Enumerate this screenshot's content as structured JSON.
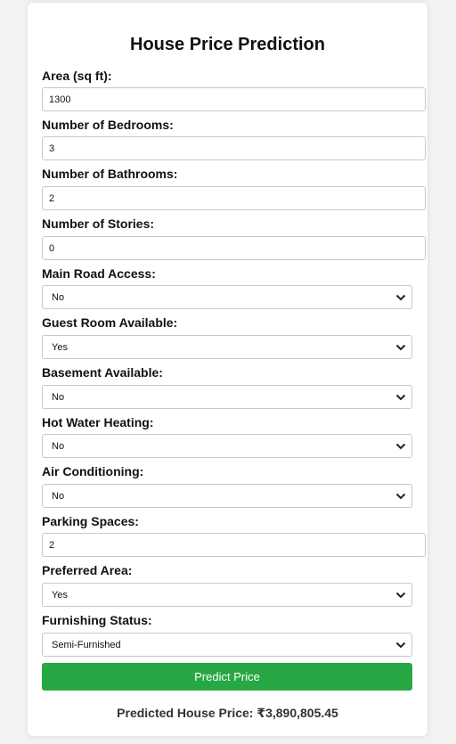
{
  "page_title": "House Price Prediction",
  "fields": [
    {
      "label": "Area (sq ft):",
      "value": "1300"
    },
    {
      "label": "Number of Bedrooms:",
      "value": "3"
    },
    {
      "label": "Number of Bathrooms:",
      "value": "2"
    },
    {
      "label": "Number of Stories:",
      "value": "0"
    },
    {
      "label": "Main Road Access:",
      "value": "No"
    },
    {
      "label": "Guest Room Available:",
      "value": "Yes"
    },
    {
      "label": "Basement Available:",
      "value": "No"
    },
    {
      "label": "Hot Water Heating:",
      "value": "No"
    },
    {
      "label": "Air Conditioning:",
      "value": "No"
    },
    {
      "label": "Parking Spaces:",
      "value": "2"
    },
    {
      "label": "Preferred Area:",
      "value": "Yes"
    },
    {
      "label": "Furnishing Status:",
      "value": "Semi-Furnished"
    }
  ],
  "predict_button": "Predict Price",
  "result_text": "Predicted House Price: ₹3,890,805.45",
  "colors": {
    "button": "#28a745",
    "background": "#f2f2f2",
    "card": "#ffffff"
  }
}
